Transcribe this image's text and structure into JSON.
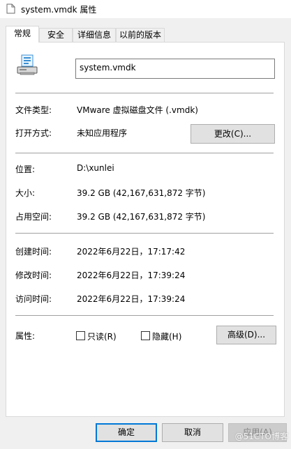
{
  "window": {
    "title": "system.vmdk 属性"
  },
  "tabs": [
    {
      "label": "常规",
      "active": true
    },
    {
      "label": "安全",
      "active": false
    },
    {
      "label": "详细信息",
      "active": false
    },
    {
      "label": "以前的版本",
      "active": false
    }
  ],
  "file": {
    "name": "system.vmdk"
  },
  "rows": {
    "type_label": "文件类型:",
    "type_value": "VMware 虚拟磁盘文件 (.vmdk)",
    "openwith_label": "打开方式:",
    "openwith_value": "未知应用程序",
    "change_button": "更改(C)...",
    "location_label": "位置:",
    "location_value": "D:\\xunlei",
    "size_label": "大小:",
    "size_value": "39.2 GB (42,167,631,872 字节)",
    "disk_label": "占用空间:",
    "disk_value": "39.2 GB (42,167,631,872 字节)",
    "created_label": "创建时间:",
    "created_value": "2022年6月22日，17:17:42",
    "modified_label": "修改时间:",
    "modified_value": "2022年6月22日，17:39:24",
    "accessed_label": "访问时间:",
    "accessed_value": "2022年6月22日，17:39:24"
  },
  "attributes": {
    "label": "属性:",
    "readonly_label": "只读(R)",
    "readonly_checked": false,
    "hidden_label": "隐藏(H)",
    "hidden_checked": false,
    "advanced_button": "高级(D)..."
  },
  "footer": {
    "ok": "确定",
    "cancel": "取消",
    "apply": "应用(A)"
  },
  "watermark": "@51CTO博客",
  "colors": {
    "accent": "#0078d7",
    "panel_bg": "#ffffff",
    "dialog_bg": "#f0f0f0"
  }
}
